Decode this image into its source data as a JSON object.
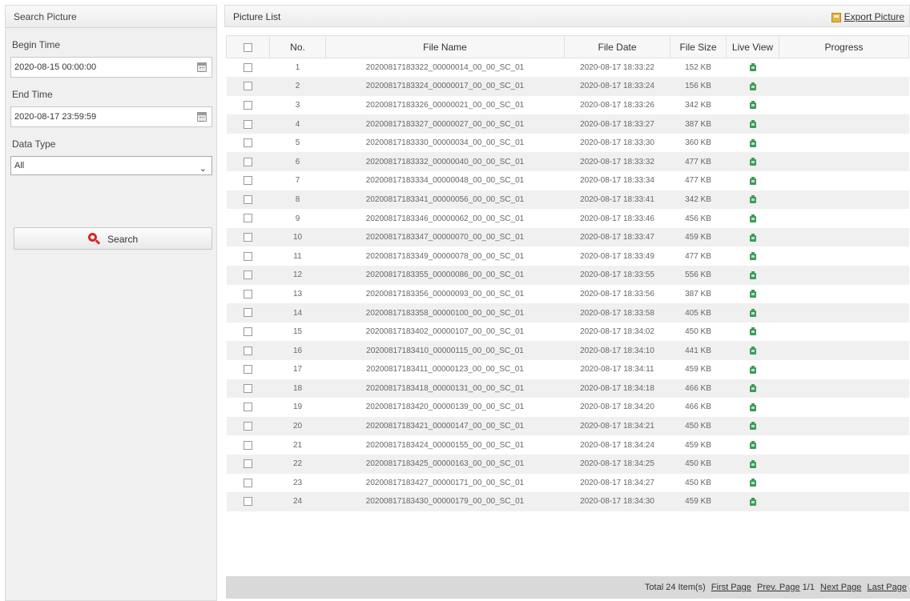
{
  "search_panel": {
    "title": "Search Picture",
    "begin_time_label": "Begin Time",
    "begin_time_value": "2020-08-15 00:00:00",
    "end_time_label": "End Time",
    "end_time_value": "2020-08-17 23:59:59",
    "data_type_label": "Data Type",
    "data_type_value": "All",
    "search_button_label": "Search"
  },
  "picture_list": {
    "title": "Picture List",
    "export_label": "Export Picture",
    "columns": [
      "No.",
      "File Name",
      "File Date",
      "File Size",
      "Live View",
      "Progress"
    ],
    "rows": [
      {
        "no": "1",
        "file_name": "20200817183322_00000014_00_00_SC_01",
        "file_date": "2020-08-17 18:33:22",
        "file_size": "152 KB"
      },
      {
        "no": "2",
        "file_name": "20200817183324_00000017_00_00_SC_01",
        "file_date": "2020-08-17 18:33:24",
        "file_size": "156 KB"
      },
      {
        "no": "3",
        "file_name": "20200817183326_00000021_00_00_SC_01",
        "file_date": "2020-08-17 18:33:26",
        "file_size": "342 KB"
      },
      {
        "no": "4",
        "file_name": "20200817183327_00000027_00_00_SC_01",
        "file_date": "2020-08-17 18:33:27",
        "file_size": "387 KB"
      },
      {
        "no": "5",
        "file_name": "20200817183330_00000034_00_00_SC_01",
        "file_date": "2020-08-17 18:33:30",
        "file_size": "360 KB"
      },
      {
        "no": "6",
        "file_name": "20200817183332_00000040_00_00_SC_01",
        "file_date": "2020-08-17 18:33:32",
        "file_size": "477 KB"
      },
      {
        "no": "7",
        "file_name": "20200817183334_00000048_00_00_SC_01",
        "file_date": "2020-08-17 18:33:34",
        "file_size": "477 KB"
      },
      {
        "no": "8",
        "file_name": "20200817183341_00000056_00_00_SC_01",
        "file_date": "2020-08-17 18:33:41",
        "file_size": "342 KB"
      },
      {
        "no": "9",
        "file_name": "20200817183346_00000062_00_00_SC_01",
        "file_date": "2020-08-17 18:33:46",
        "file_size": "456 KB"
      },
      {
        "no": "10",
        "file_name": "20200817183347_00000070_00_00_SC_01",
        "file_date": "2020-08-17 18:33:47",
        "file_size": "459 KB"
      },
      {
        "no": "11",
        "file_name": "20200817183349_00000078_00_00_SC_01",
        "file_date": "2020-08-17 18:33:49",
        "file_size": "477 KB"
      },
      {
        "no": "12",
        "file_name": "20200817183355_00000086_00_00_SC_01",
        "file_date": "2020-08-17 18:33:55",
        "file_size": "556 KB"
      },
      {
        "no": "13",
        "file_name": "20200817183356_00000093_00_00_SC_01",
        "file_date": "2020-08-17 18:33:56",
        "file_size": "387 KB"
      },
      {
        "no": "14",
        "file_name": "20200817183358_00000100_00_00_SC_01",
        "file_date": "2020-08-17 18:33:58",
        "file_size": "405 KB"
      },
      {
        "no": "15",
        "file_name": "20200817183402_00000107_00_00_SC_01",
        "file_date": "2020-08-17 18:34:02",
        "file_size": "450 KB"
      },
      {
        "no": "16",
        "file_name": "20200817183410_00000115_00_00_SC_01",
        "file_date": "2020-08-17 18:34:10",
        "file_size": "441 KB"
      },
      {
        "no": "17",
        "file_name": "20200817183411_00000123_00_00_SC_01",
        "file_date": "2020-08-17 18:34:11",
        "file_size": "459 KB"
      },
      {
        "no": "18",
        "file_name": "20200817183418_00000131_00_00_SC_01",
        "file_date": "2020-08-17 18:34:18",
        "file_size": "466 KB"
      },
      {
        "no": "19",
        "file_name": "20200817183420_00000139_00_00_SC_01",
        "file_date": "2020-08-17 18:34:20",
        "file_size": "466 KB"
      },
      {
        "no": "20",
        "file_name": "20200817183421_00000147_00_00_SC_01",
        "file_date": "2020-08-17 18:34:21",
        "file_size": "450 KB"
      },
      {
        "no": "21",
        "file_name": "20200817183424_00000155_00_00_SC_01",
        "file_date": "2020-08-17 18:34:24",
        "file_size": "459 KB"
      },
      {
        "no": "22",
        "file_name": "20200817183425_00000163_00_00_SC_01",
        "file_date": "2020-08-17 18:34:25",
        "file_size": "450 KB"
      },
      {
        "no": "23",
        "file_name": "20200817183427_00000171_00_00_SC_01",
        "file_date": "2020-08-17 18:34:27",
        "file_size": "450 KB"
      },
      {
        "no": "24",
        "file_name": "20200817183430_00000179_00_00_SC_01",
        "file_date": "2020-08-17 18:34:30",
        "file_size": "459 KB"
      }
    ]
  },
  "pagination": {
    "total_text": "Total 24 Item(s)",
    "first_page": "First Page",
    "prev_page": "Prev. Page",
    "page_indicator": "1/1",
    "next_page": "Next Page",
    "last_page": "Last Page"
  },
  "icons": {
    "calendar": "calendar-icon",
    "search": "search-icon",
    "export": "export-picture-icon",
    "live_view": "live-view-camera-icon"
  },
  "colors": {
    "search_icon": "#d9281f",
    "live_view_icon": "#3e9a5a",
    "export_icon": "#e8b33a",
    "footer_bar": "#d9d9d9"
  }
}
